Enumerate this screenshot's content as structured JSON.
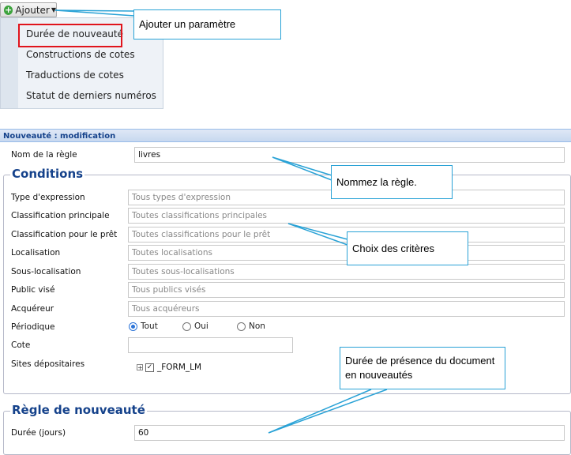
{
  "toolbar": {
    "add_label": "Ajouter"
  },
  "menu": {
    "items": [
      "Durée de nouveauté",
      "Constructions de cotes",
      "Traductions de cotes",
      "Statut de derniers numéros"
    ]
  },
  "callouts": {
    "add_param": "Ajouter un paramètre",
    "name_rule": "Nommez la règle.",
    "criteria": "Choix des critères",
    "duration_line1": "Durée de présence du document",
    "duration_line2": "en nouveautés"
  },
  "panel": {
    "title": "Nouveauté : modification"
  },
  "rule": {
    "name_label": "Nom de la règle",
    "name_value": "livres"
  },
  "conditions": {
    "legend": "Conditions",
    "fields": [
      {
        "label": "Type d'expression",
        "placeholder": "Tous types d'expression"
      },
      {
        "label": "Classification principale",
        "placeholder": "Toutes classifications principales"
      },
      {
        "label": "Classification pour le prêt",
        "placeholder": "Toutes classifications pour le prêt"
      },
      {
        "label": "Localisation",
        "placeholder": "Toutes localisations"
      },
      {
        "label": "Sous-localisation",
        "placeholder": "Toutes sous-localisations"
      },
      {
        "label": "Public visé",
        "placeholder": "Tous publics visés"
      },
      {
        "label": "Acquéreur",
        "placeholder": "Tous acquéreurs"
      }
    ],
    "periodic": {
      "label": "Périodique",
      "options": [
        "Tout",
        "Oui",
        "Non"
      ],
      "selected": "Tout"
    },
    "cote": {
      "label": "Cote",
      "value": ""
    },
    "sites": {
      "label": "Sites dépositaires",
      "node": "_FORM_LM",
      "checked": true
    }
  },
  "novelty": {
    "legend": "Règle de nouveauté",
    "duration_label": "Durée (jours)",
    "duration_value": "60"
  },
  "colors": {
    "callout_border": "#29a2d6",
    "highlight": "#e0141c",
    "legend": "#15428b"
  }
}
